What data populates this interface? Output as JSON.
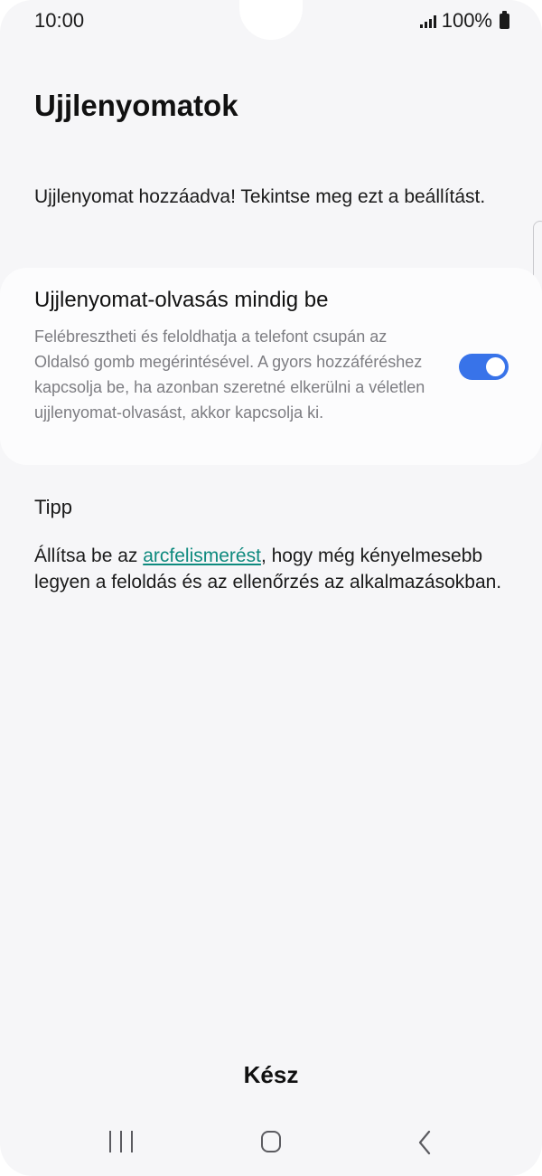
{
  "status_bar": {
    "time": "10:00",
    "battery": "100%",
    "icons": [
      "signal-icon",
      "battery-icon"
    ]
  },
  "page": {
    "title": "Ujjlenyomatok",
    "intro": "Ujjlenyomat hozzáadva! Tekintse meg ezt a beállítást."
  },
  "setting": {
    "title": "Ujjlenyomat-olvasás mindig be",
    "description": "Felébresztheti és feloldhatja a telefont csupán az Oldalsó gomb megérintésével. A gyors hozzáféréshez kapcsolja be, ha azonban szeretné elkerülni a véletlen ujjlenyomat-olvasást, akkor kapcsolja ki.",
    "enabled": true
  },
  "tip": {
    "heading": "Tipp",
    "text_before": "Állítsa be az ",
    "link": "arcfelismerést",
    "text_after": ", hogy még kényelmesebb legyen a feloldás és az ellenőrzés az alkalmazásokban."
  },
  "footer": {
    "done_label": "Kész"
  },
  "nav": {
    "icons": [
      "recent-apps-icon",
      "home-icon",
      "back-icon"
    ]
  },
  "colors": {
    "accent": "#3873e9",
    "link": "#0e8a7e",
    "background": "#f6f6f8"
  }
}
